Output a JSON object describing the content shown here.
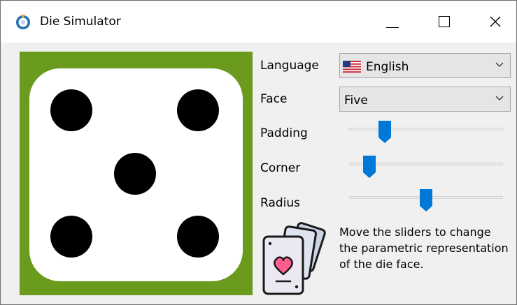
{
  "window": {
    "title": "Die Simulator",
    "controls": {
      "minimize": "minimize",
      "maximize": "maximize",
      "close": "close"
    }
  },
  "die": {
    "face": 5,
    "background_color": "#6a9b1d",
    "face_color": "#ffffff",
    "pip_color": "#000000"
  },
  "form": {
    "language": {
      "label": "Language",
      "value": "English",
      "icon": "us-flag-icon"
    },
    "face": {
      "label": "Face",
      "value": "Five"
    },
    "padding": {
      "label": "Padding",
      "level": 0.23
    },
    "corner": {
      "label": "Corner",
      "level": 0.13
    },
    "radius": {
      "label": "Radius",
      "level": 0.5
    }
  },
  "info": {
    "icon": "cards-heart-icon",
    "text": "Move the sliders to change the parametric representation of the die face."
  },
  "colors": {
    "accent": "#0078d7"
  }
}
